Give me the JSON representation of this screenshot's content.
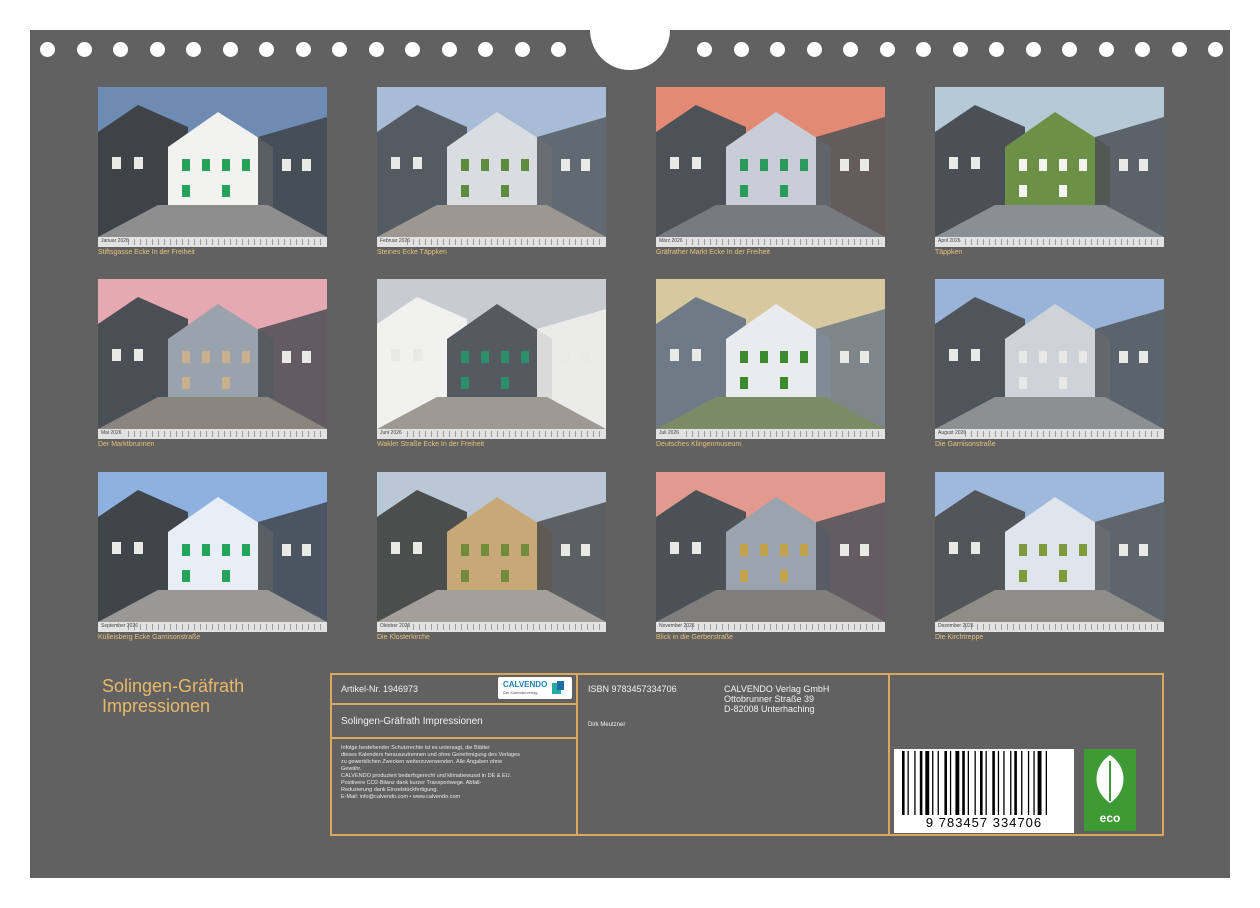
{
  "months": [
    {
      "label": "Januar 2026",
      "caption": "Stiftsgasse Ecke In der Freiheit",
      "colors": [
        "#6e8bb3",
        "#f2f2f0",
        "#3f4348",
        "#27a25b",
        "#8e8e8e"
      ]
    },
    {
      "label": "Februar 2026",
      "caption": "Steines Ecke Täppken",
      "colors": [
        "#a7bcd6",
        "#d9dde2",
        "#555b62",
        "#5e8c3f",
        "#9c9891"
      ]
    },
    {
      "label": "März 2026",
      "caption": "Gräfrather Markt Ecke In der Freiheit",
      "colors": [
        "#e38a74",
        "#c9cdd7",
        "#4d5258",
        "#2b9a5a",
        "#777b80"
      ]
    },
    {
      "label": "April 2026",
      "caption": "Täppken",
      "colors": [
        "#b6c9d6",
        "#6c9046",
        "#4b5057",
        "#f3f3f0",
        "#8a8f94"
      ]
    },
    {
      "label": "Mai 2026",
      "caption": "Der Marktbrunnen",
      "colors": [
        "#e6a8b1",
        "#9aa3ad",
        "#4a4f55",
        "#c9b08d",
        "#8b8580"
      ]
    },
    {
      "label": "Juni 2026",
      "caption": "Wakler Straße Ecke In der Freiheit",
      "colors": [
        "#c8ccd1",
        "#555a60",
        "#f1f1ef",
        "#2d8f6a",
        "#9d9a94"
      ]
    },
    {
      "label": "Juli 2026",
      "caption": "Deutsches Klingenmuseum",
      "colors": [
        "#d8c8a0",
        "#e9ebee",
        "#6e7a86",
        "#3c8a2e",
        "#7b8b66"
      ]
    },
    {
      "label": "August 2026",
      "caption": "Die Garnisonstraße",
      "colors": [
        "#99b4d8",
        "#cfd3d8",
        "#50555b",
        "#e8e8e6",
        "#8d8f91"
      ]
    },
    {
      "label": "September 2026",
      "caption": "Külleisberg Ecke Garnisonstraße",
      "colors": [
        "#8fb1e0",
        "#e8eef6",
        "#3f454b",
        "#24a35a",
        "#9a9896"
      ]
    },
    {
      "label": "Oktober 2026",
      "caption": "Die Klosterkirche",
      "colors": [
        "#bac7d6",
        "#c9a878",
        "#4c4e4d",
        "#718c3d",
        "#a3a09b"
      ]
    },
    {
      "label": "November 2026",
      "caption": "Blick in die Gerberstraße",
      "colors": [
        "#e29a8e",
        "#9aa3ae",
        "#4c5158",
        "#c1a14a",
        "#7f7e7d"
      ]
    },
    {
      "label": "Dezember 2026",
      "caption": "Die Kirchtreppe",
      "colors": [
        "#9fb9dc",
        "#dfe5ec",
        "#535659",
        "#7f9a3a",
        "#8f8d88"
      ]
    }
  ],
  "title": {
    "line1": "Solingen-Gräfrath",
    "line2": "Impressionen"
  },
  "info": {
    "article": "Artikel-Nr. 1946973",
    "logo_text": "CALVENDO",
    "logo_sub": "Der Kalenderverlag",
    "subtitle": "Solingen-Gräfrath Impressionen",
    "legal": [
      "Infolge bestehender Schutzrechte ist es untersagt, die Blätter",
      "dieses Kalenders herauszutrennen und ohne Genehmigung des Verlages",
      "zu gewerblichen Zwecken weiterzuverwenden. Alle Angaben ohne",
      "Gewähr.",
      "CALVENDO produziert bedarfsgerecht und klimabewusst in DE & EU.",
      "Positivere CO2-Bilanz dank kurzer Transportwege. Abfall-",
      "Reduzierung dank Einzelstückfertigung.",
      "E-Mail: info@calvendo.com • www.calvendo.com"
    ],
    "isbn": "ISBN 9783457334706",
    "author": "Dirk Meutzner",
    "publisher": [
      "CALVENDO Verlag GmbH",
      "Ottobrunner Straße 39",
      "D-82008 Unterhaching"
    ],
    "barcode_number": "9 783457 334706",
    "eco_label": "eco"
  },
  "colors": {
    "background": "#616161",
    "accent": "#e8b868",
    "frame": "#d9a85e"
  }
}
